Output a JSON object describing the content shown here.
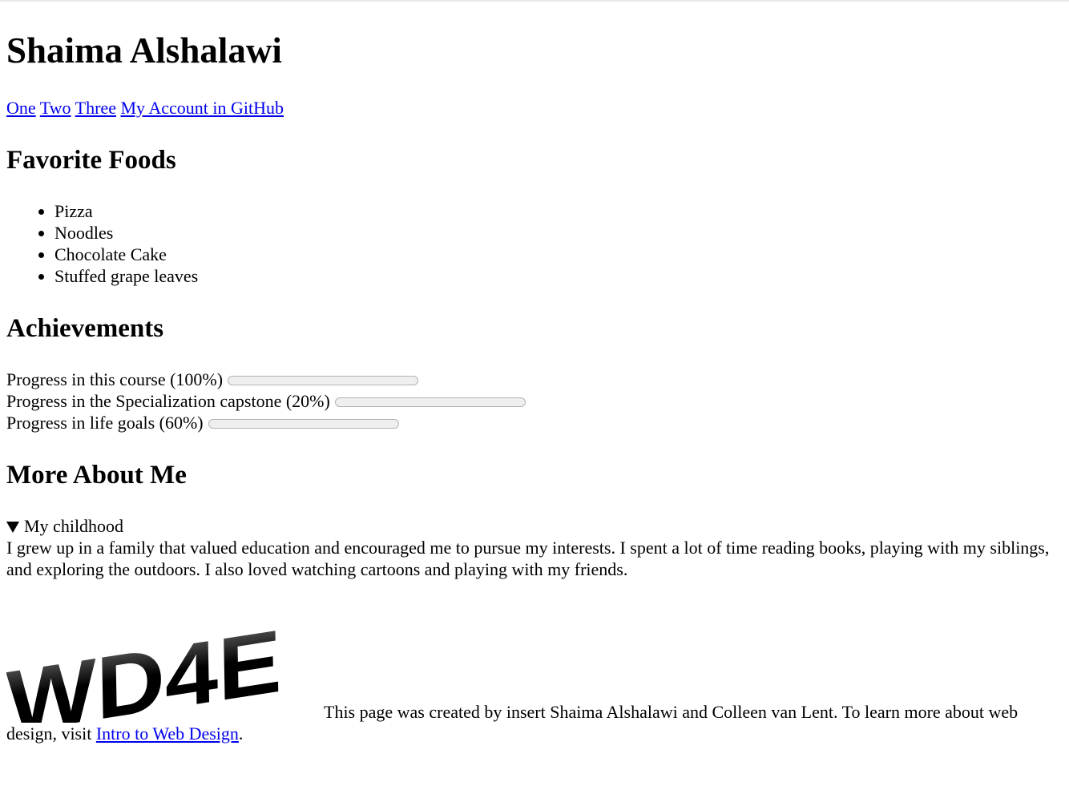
{
  "header": {
    "title": "Shaima Alshalawi"
  },
  "nav": {
    "links": [
      "One",
      "Two",
      "Three",
      "My Account in GitHub"
    ]
  },
  "foods": {
    "heading": "Favorite Foods",
    "items": [
      "Pizza",
      "Noodles",
      "Chocolate Cake",
      "Stuffed grape leaves"
    ]
  },
  "achievements": {
    "heading": "Achievements",
    "items": [
      {
        "label": "Progress in this course (100%)",
        "value": 1.0
      },
      {
        "label": "Progress in the Specialization capstone (20%)",
        "value": 0.2
      },
      {
        "label": "Progress in life goals (60%)",
        "value": 0.6
      }
    ]
  },
  "about": {
    "heading": "More About Me",
    "summary": "My childhood",
    "text": "I grew up in a family that valued education and encouraged me to pursue my interests. I spent a lot of time reading books, playing with my siblings, and exploring the outdoors. I also loved watching cartoons and playing with my friends."
  },
  "footer": {
    "logo_text": "WD4E",
    "text_before": "This page was created by insert Shaima Alshalawi and Colleen van Lent. To learn more about web design, visit ",
    "link": "Intro to Web Design",
    "text_after": "."
  },
  "colors": {
    "link": "#0000ee",
    "bar_fill": "#747474",
    "bar_track": "#efefef"
  }
}
